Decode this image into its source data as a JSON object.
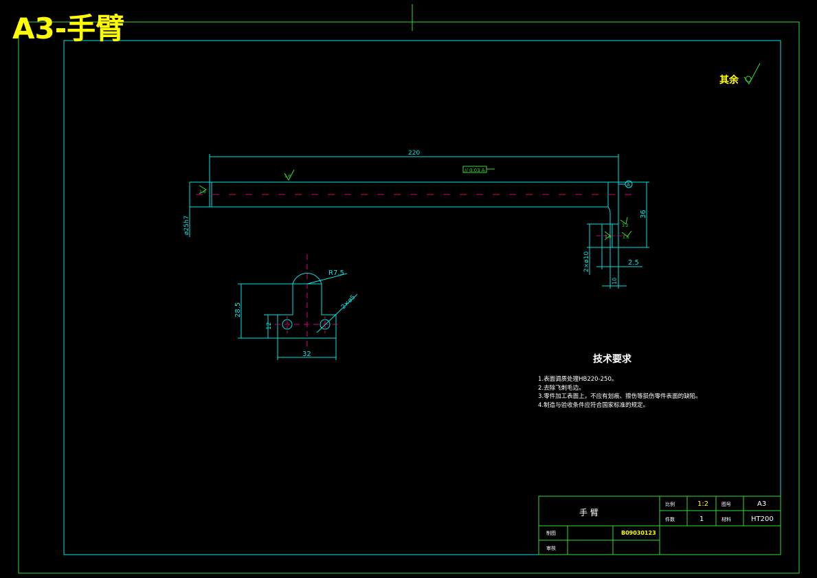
{
  "banner": "A3-手臂",
  "roughness_other": "其余",
  "dimensions": {
    "overall_length": "220",
    "shaft_dia": "ø25h7",
    "total_height": "36",
    "holes": "2×ø10",
    "thickness": "2.5",
    "small_dim": "10",
    "radius": "R7.5",
    "hole_dia": "2×ø5",
    "height": "28.5",
    "hole_height": "12",
    "width": "32",
    "tolerance": "// 0.03 A",
    "datum": "A"
  },
  "roughness_marks": [
    "1.6",
    "1.6",
    "3.2",
    "1.6",
    "1.6"
  ],
  "tech_requirements": {
    "title": "技术要求",
    "items": [
      "1.表面调质处理HB220-250。",
      "2.去除飞刺毛边。",
      "3.零件加工表面上，不应有划痕、擦伤等损伤零件表面的缺陷。",
      "4.制造与验收条件应符合国家标准的规定。"
    ]
  },
  "title_block": {
    "part_name": "手    臂",
    "scale_label": "比例",
    "scale": "1:2",
    "sheet_label": "图号",
    "sheet": "A3",
    "qty_label": "件数",
    "qty": "1",
    "material_label": "材料",
    "material": "HT200",
    "drawn_label": "制图",
    "drawing_no": "B09030123",
    "check_label": "审核"
  },
  "colors": {
    "frame": "#00e5e5",
    "dimension": "#33dd33",
    "centerline": "#e0007a",
    "text": "#ffffff",
    "banner": "#ffff00"
  }
}
